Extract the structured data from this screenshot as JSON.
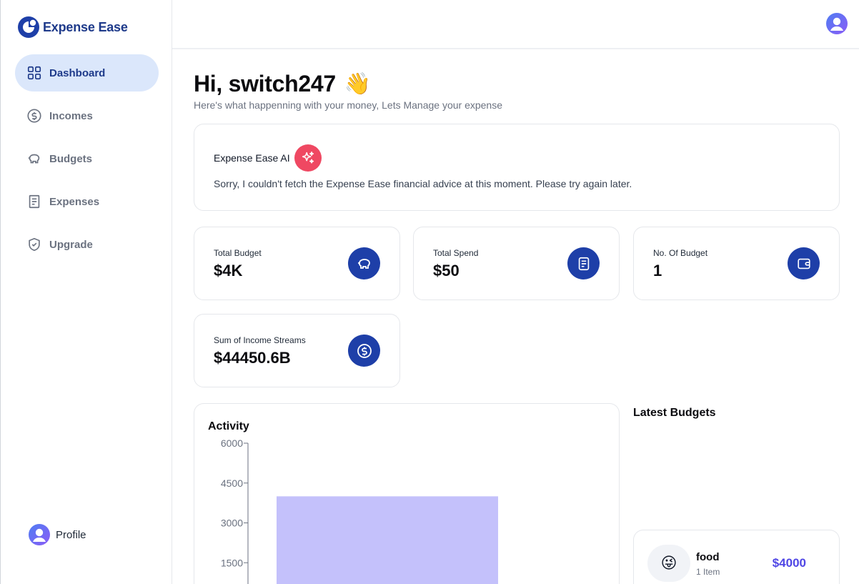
{
  "app": {
    "name": "Expense Ease",
    "brand_color": "#1e3a8a",
    "accent_color": "#1e3fa8"
  },
  "sidebar": {
    "items": [
      {
        "label": "Dashboard",
        "icon": "dashboard-grid-icon",
        "active": true
      },
      {
        "label": "Incomes",
        "icon": "dollar-circle-icon",
        "active": false
      },
      {
        "label": "Budgets",
        "icon": "piggy-bank-icon",
        "active": false
      },
      {
        "label": "Expenses",
        "icon": "receipt-icon",
        "active": false
      },
      {
        "label": "Upgrade",
        "icon": "shield-check-icon",
        "active": false
      }
    ],
    "profile_label": "Profile"
  },
  "header": {
    "greeting": "Hi, switch247",
    "greeting_emoji": "👋",
    "subtitle": "Here's what happenning with your money, Lets Manage your expense"
  },
  "ai": {
    "title": "Expense Ease AI",
    "message": "Sorry, I couldn't fetch the Expense Ease financial advice at this moment. Please try again later.",
    "badge_color": "#ef4862"
  },
  "stats": [
    {
      "label": "Total Budget",
      "value": "$4K",
      "icon": "piggy-bank-icon"
    },
    {
      "label": "Total Spend",
      "value": "$50",
      "icon": "receipt-icon"
    },
    {
      "label": "No. Of Budget",
      "value": "1",
      "icon": "wallet-icon"
    },
    {
      "label": "Sum of Income Streams",
      "value": "$44450.6B",
      "icon": "dollar-circle-icon"
    }
  ],
  "activity": {
    "title": "Activity"
  },
  "chart_data": {
    "type": "bar",
    "title": "Activity",
    "yticks": [
      6000,
      4500,
      3000,
      1500
    ],
    "ylim": [
      0,
      6000
    ],
    "bar_color": "#c4c1fb",
    "series": [
      {
        "values": [
          4000
        ]
      }
    ]
  },
  "latest_budgets": {
    "title": "Latest Budgets",
    "items": [
      {
        "emoji": "😜",
        "name": "food",
        "items": "1 Item",
        "amount": "$4000"
      }
    ]
  }
}
